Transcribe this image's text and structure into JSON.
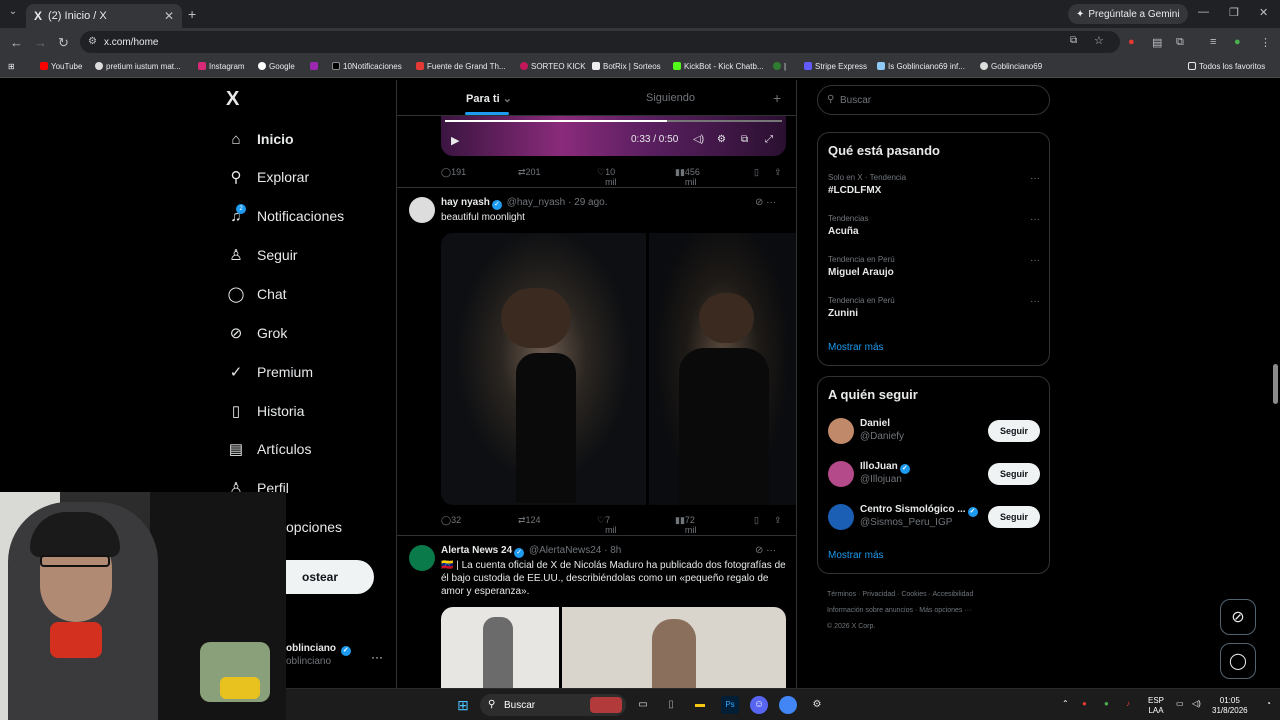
{
  "browser": {
    "tab_title": "(2) Inicio / X",
    "tab_favicon": "X",
    "gemini_label": "Pregúntale a Gemini",
    "url": "x.com/home",
    "bookmarks": [
      "YouTube",
      "pretium iustum mat...",
      "Instagram",
      "Google",
      "10Notificaciones",
      "Fuente de Grand Th...",
      "SORTEO KICK",
      "BotRix | Sorteos",
      "KickBot - Kick Chatb...",
      "Stripe Express",
      "Is Goblinciano69 inf...",
      "Goblinciano69"
    ],
    "all_bookmarks": "Todos los favoritos"
  },
  "sidebar": {
    "logo": "X",
    "badge_count": "2",
    "items": [
      {
        "label": "Inicio",
        "icon": "home-icon"
      },
      {
        "label": "Explorar",
        "icon": "search-icon"
      },
      {
        "label": "Notificaciones",
        "icon": "bell-icon"
      },
      {
        "label": "Seguir",
        "icon": "add-person-icon"
      },
      {
        "label": "Chat",
        "icon": "chat-icon"
      },
      {
        "label": "Grok",
        "icon": "grok-icon"
      },
      {
        "label": "Premium",
        "icon": "premium-icon"
      },
      {
        "label": "Historia",
        "icon": "bookmark-icon"
      },
      {
        "label": "Artículos",
        "icon": "article-icon"
      },
      {
        "label": "Perfil",
        "icon": "person-icon"
      },
      {
        "label": "opciones",
        "icon": "more-icon"
      }
    ],
    "post_button": "ostear",
    "account_name": "oblinciano",
    "account_handle": "oblinciano"
  },
  "feed": {
    "tabs": [
      "Para ti",
      "Siguiendo"
    ],
    "video": {
      "time": "0:33 / 0:50",
      "progress": 0.66
    },
    "video_actions": {
      "replies": "191",
      "reposts": "201",
      "likes": "10 mil",
      "views": "456 mil"
    },
    "tweet1": {
      "name": "hay nyash",
      "handle": "@hay_nyash",
      "time": "29 ago.",
      "text": "beautiful moonlight",
      "actions": {
        "replies": "32",
        "reposts": "124",
        "likes": "7 mil",
        "views": "72 mil"
      }
    },
    "tweet2": {
      "name": "Alerta News 24",
      "handle": "@AlertaNews24",
      "time": "8h",
      "text": "🇻🇪 | La cuenta oficial de X de Nicolás Maduro ha publicado dos fotografías de él bajo custodia de EE.UU., describiéndolas como un «pequeño regalo de amor y esperanza»."
    }
  },
  "right": {
    "search_placeholder": "Buscar",
    "trends_title": "Qué está pasando",
    "trends": [
      {
        "category": "Solo en X · Tendencia",
        "name": "#LCDLFMX"
      },
      {
        "category": "Tendencias",
        "name": "Acuña"
      },
      {
        "category": "Tendencia en Perú",
        "name": "Miguel Araujo"
      },
      {
        "category": "Tendencia en Perú",
        "name": "Zunini"
      }
    ],
    "show_more": "Mostrar más",
    "who_title": "A quién seguir",
    "who": [
      {
        "name": "Daniel",
        "handle": "@Daniefy",
        "verified": false
      },
      {
        "name": "IlloJuan",
        "handle": "@Illojuan",
        "verified": true
      },
      {
        "name": "Centro Sismológico ...",
        "handle": "@Sismos_Peru_IGP",
        "verified": true
      }
    ],
    "follow_label": "Seguir",
    "footer": [
      "Términos",
      "Privacidad",
      "Cookies",
      "Accesibilidad",
      "Información sobre anuncios",
      "Más opciones ···",
      "© 2026 X Corp."
    ]
  },
  "taskbar": {
    "search": "Buscar",
    "lang1": "ESP",
    "lang2": "LAA",
    "time": "01:05",
    "date": "31/8/2026"
  }
}
